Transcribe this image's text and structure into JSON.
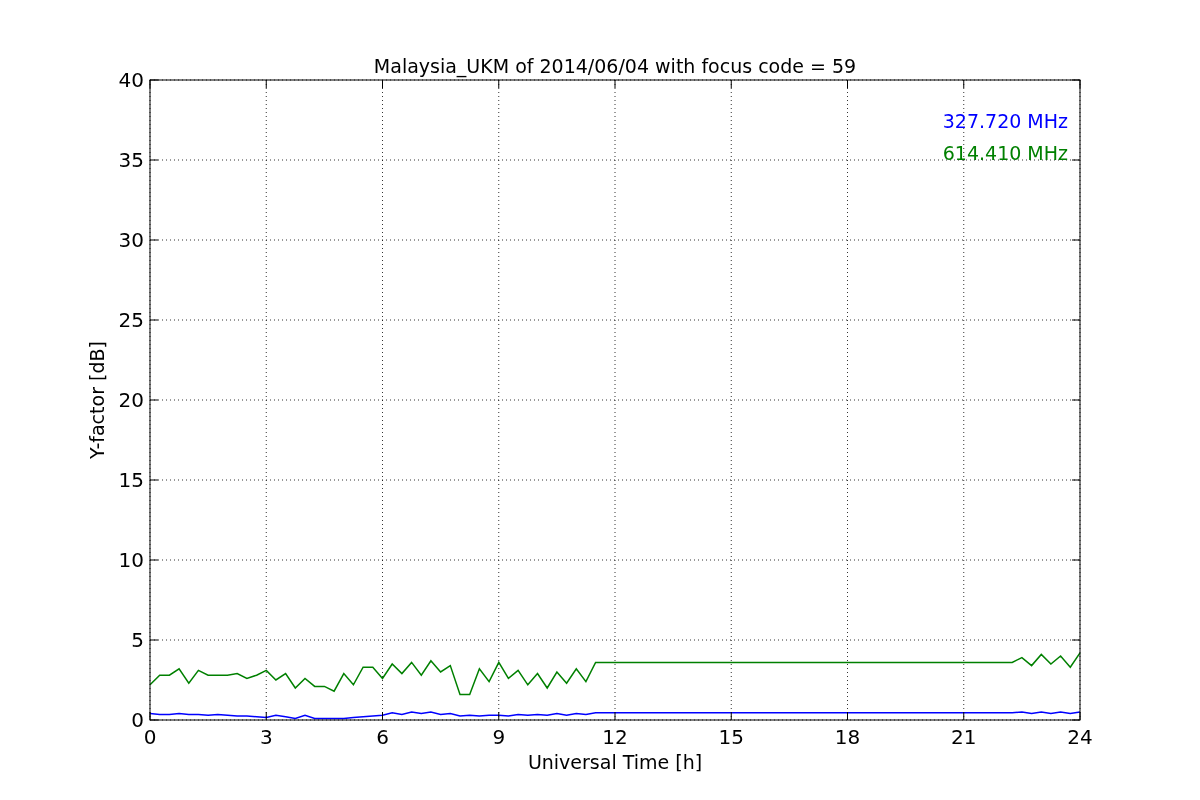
{
  "figure": {
    "chart_data": {
      "type": "line",
      "title": "Malaysia_UKM of 2014/06/04 with focus code = 59",
      "xlabel": "Universal Time [h]",
      "ylabel": "Y-factor [dB]",
      "xlim": [
        0,
        24
      ],
      "ylim": [
        0,
        40
      ],
      "grid": true,
      "xticks": [
        0,
        3,
        6,
        9,
        12,
        15,
        18,
        21,
        24
      ],
      "yticks": [
        0,
        5,
        10,
        15,
        20,
        25,
        30,
        35,
        40
      ],
      "x": [
        0,
        0.25,
        0.5,
        0.75,
        1,
        1.25,
        1.5,
        1.75,
        2,
        2.25,
        2.5,
        2.75,
        3,
        3.25,
        3.5,
        3.75,
        4,
        4.25,
        4.5,
        4.75,
        5,
        5.25,
        5.5,
        5.75,
        6,
        6.25,
        6.5,
        6.75,
        7,
        7.25,
        7.5,
        7.75,
        8,
        8.25,
        8.5,
        8.75,
        9,
        9.25,
        9.5,
        9.75,
        10,
        10.25,
        10.5,
        10.75,
        11,
        11.25,
        11.5,
        11.75,
        12,
        12.25,
        12.5,
        12.75,
        13,
        13.25,
        13.5,
        13.75,
        14,
        14.25,
        14.5,
        14.75,
        15,
        15.25,
        15.5,
        15.75,
        16,
        16.25,
        16.5,
        16.75,
        17,
        17.25,
        17.5,
        17.75,
        18,
        18.25,
        18.5,
        18.75,
        19,
        19.25,
        19.5,
        19.75,
        20,
        20.25,
        20.5,
        20.75,
        21,
        21.25,
        21.5,
        21.75,
        22,
        22.25,
        22.5,
        22.75,
        23,
        23.25,
        23.5,
        23.75,
        24
      ],
      "series": [
        {
          "name": "327.720 MHz",
          "color": "#0000ff",
          "values": [
            0.4,
            0.35,
            0.35,
            0.4,
            0.35,
            0.35,
            0.3,
            0.35,
            0.3,
            0.25,
            0.25,
            0.2,
            0.15,
            0.3,
            0.2,
            0.1,
            0.3,
            0.1,
            0.1,
            0.1,
            0.1,
            0.15,
            0.2,
            0.25,
            0.3,
            0.45,
            0.35,
            0.5,
            0.4,
            0.5,
            0.35,
            0.4,
            0.25,
            0.3,
            0.25,
            0.3,
            0.3,
            0.25,
            0.35,
            0.3,
            0.35,
            0.3,
            0.4,
            0.3,
            0.4,
            0.35,
            0.45,
            0.45,
            0.45,
            0.45,
            0.45,
            0.45,
            0.45,
            0.45,
            0.45,
            0.45,
            0.45,
            0.45,
            0.45,
            0.45,
            0.45,
            0.45,
            0.45,
            0.45,
            0.45,
            0.45,
            0.45,
            0.45,
            0.45,
            0.45,
            0.45,
            0.45,
            0.45,
            0.45,
            0.45,
            0.45,
            0.45,
            0.45,
            0.45,
            0.45,
            0.45,
            0.45,
            0.45,
            0.45,
            0.45,
            0.45,
            0.45,
            0.45,
            0.45,
            0.45,
            0.5,
            0.4,
            0.5,
            0.4,
            0.5,
            0.4,
            0.5
          ]
        },
        {
          "name": "614.410 MHz",
          "color": "#008000",
          "values": [
            2.2,
            2.8,
            2.8,
            3.2,
            2.3,
            3.1,
            2.8,
            2.8,
            2.8,
            2.9,
            2.6,
            2.8,
            3.1,
            2.5,
            2.9,
            2.0,
            2.6,
            2.1,
            2.1,
            1.8,
            2.9,
            2.2,
            3.3,
            3.3,
            2.6,
            3.5,
            2.9,
            3.6,
            2.8,
            3.7,
            3.0,
            3.4,
            1.6,
            1.6,
            3.2,
            2.4,
            3.6,
            2.6,
            3.1,
            2.2,
            2.9,
            2.0,
            3.0,
            2.3,
            3.2,
            2.4,
            3.6,
            3.6,
            3.6,
            3.6,
            3.6,
            3.6,
            3.6,
            3.6,
            3.6,
            3.6,
            3.6,
            3.6,
            3.6,
            3.6,
            3.6,
            3.6,
            3.6,
            3.6,
            3.6,
            3.6,
            3.6,
            3.6,
            3.6,
            3.6,
            3.6,
            3.6,
            3.6,
            3.6,
            3.6,
            3.6,
            3.6,
            3.6,
            3.6,
            3.6,
            3.6,
            3.6,
            3.6,
            3.6,
            3.6,
            3.6,
            3.6,
            3.6,
            3.6,
            3.6,
            3.9,
            3.4,
            4.1,
            3.5,
            4.0,
            3.3,
            4.2
          ]
        }
      ]
    }
  }
}
